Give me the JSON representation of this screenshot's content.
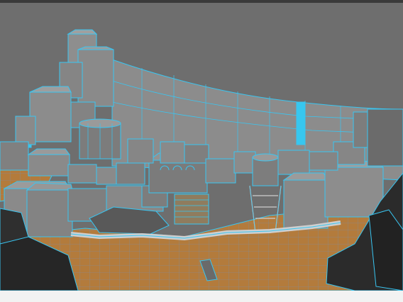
{
  "viewport": {
    "view": "perspective",
    "display_mode": "wireframe-on-shaded",
    "content": "3d-town-scene",
    "colors": {
      "background": "#6e6e6e",
      "wireframe": "#39c6f2",
      "building_fill": "#8a8a8a",
      "building_dark": "#2c2c2c",
      "ground": "#b07a3a",
      "frame_top": "#3a3a3a",
      "frame_bottom": "#f2f2f2"
    }
  }
}
